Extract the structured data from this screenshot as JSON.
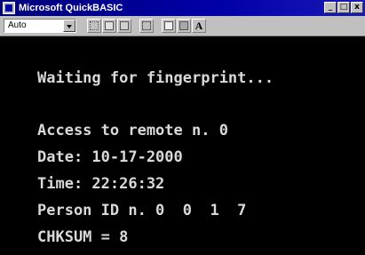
{
  "window": {
    "title": "Microsoft QuickBASIC",
    "buttons": {
      "minimize": "_",
      "maximize": "□",
      "close": "x"
    }
  },
  "toolbar": {
    "font_select": {
      "value": "Auto"
    },
    "buttons": [
      "mark-icon",
      "copy-icon",
      "paste-icon",
      "fullscreen-icon",
      "properties-icon",
      "background-icon",
      "font-icon"
    ],
    "font_button_label": "A"
  },
  "console": {
    "lines": [
      "Waiting for fingerprint...",
      "Access to remote n. 0",
      "Date: 10-17-2000",
      "Time: 22:26:32",
      "Person ID n. 0  0  1  7",
      "CHKSUM = 8"
    ],
    "text_color": "#d9d9d9",
    "background": "#000000"
  },
  "colors": {
    "titlebar": "#0000a8",
    "chrome": "#c0c0c0"
  }
}
